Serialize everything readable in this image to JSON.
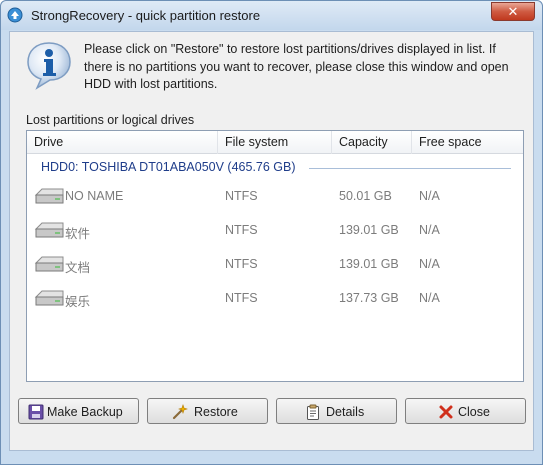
{
  "window": {
    "title": "StrongRecovery - quick partition restore",
    "close_glyph": "✕"
  },
  "info": {
    "icon": "info-icon",
    "message": "Please click on \"Restore\" to restore lost partitions/drives displayed in list. If there is no partitions you want to recover, please close this window and open HDD with lost partitions."
  },
  "list": {
    "group_box_label": "Lost partitions or logical drives",
    "columns": [
      "Drive",
      "File system",
      "Capacity",
      "Free space"
    ],
    "group_title": "HDD0: TOSHIBA DT01ABA050V (465.76 GB)",
    "rows": [
      {
        "drive": "NO NAME",
        "fs": "NTFS",
        "capacity": "50.01 GB",
        "free": "N/A"
      },
      {
        "drive": "软件",
        "fs": "NTFS",
        "capacity": "139.01 GB",
        "free": "N/A"
      },
      {
        "drive": "文档",
        "fs": "NTFS",
        "capacity": "139.01 GB",
        "free": "N/A"
      },
      {
        "drive": "娱乐",
        "fs": "NTFS",
        "capacity": "137.73 GB",
        "free": "N/A"
      }
    ]
  },
  "buttons": {
    "make_backup": "Make Backup",
    "restore": "Restore",
    "details": "Details",
    "close": "Close"
  },
  "colors": {
    "group_title": "#1f3d8a",
    "row_text": "#7c7c7c",
    "close_accent": "#cf5b42"
  }
}
